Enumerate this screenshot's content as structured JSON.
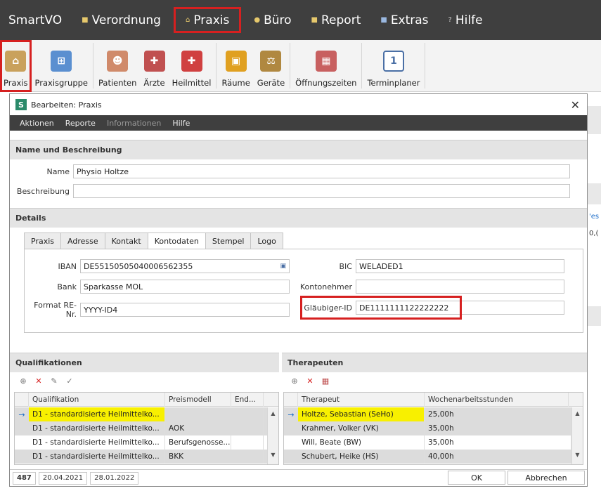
{
  "app": {
    "brand": "SmartVO",
    "menus": [
      {
        "label": "Verordnung",
        "icon": "verordnung-icon"
      },
      {
        "label": "Praxis",
        "icon": "home-icon",
        "active": true
      },
      {
        "label": "Büro",
        "icon": "buero-icon"
      },
      {
        "label": "Report",
        "icon": "report-icon"
      },
      {
        "label": "Extras",
        "icon": "extras-icon"
      },
      {
        "label": "Hilfe",
        "icon": "help-icon"
      }
    ]
  },
  "ribbon": [
    {
      "label": "Praxis",
      "icon": "house-icon",
      "color": "#c9a15c",
      "selected": true
    },
    {
      "label": "Praxisgruppe",
      "icon": "network-icon",
      "color": "#5a8fd0"
    },
    {
      "label": "Patienten",
      "icon": "patient-icon",
      "color": "#d08a6a"
    },
    {
      "label": "Ärzte",
      "icon": "doctor-icon",
      "color": "#c05050"
    },
    {
      "label": "Heilmittel",
      "icon": "firstaid-icon",
      "color": "#d04040"
    },
    {
      "label": "Räume",
      "icon": "lock-icon",
      "color": "#e0a020"
    },
    {
      "label": "Geräte",
      "icon": "scales-icon",
      "color": "#b08840"
    },
    {
      "label": "Öffnungszeiten",
      "icon": "calendar-icon",
      "color": "#c86060"
    },
    {
      "label": "Terminplaner",
      "icon": "calendar-day-icon",
      "color": "#4a6fa5",
      "glyph": "1"
    }
  ],
  "dialog": {
    "title": "Bearbeiten: Praxis",
    "icon_letter": "S",
    "close": "✕",
    "menu": [
      "Aktionen",
      "Reporte",
      "Informationen",
      "Hilfe"
    ],
    "name_section": "Name und Beschreibung",
    "name_label": "Name",
    "name_value": "Physio Holtze",
    "desc_label": "Beschreibung",
    "desc_value": "",
    "details_section": "Details",
    "tabs": [
      "Praxis",
      "Adresse",
      "Kontakt",
      "Kontodaten",
      "Stempel",
      "Logo"
    ],
    "active_tab": "Kontodaten",
    "iban_label": "IBAN",
    "iban_value": "DE55150505040006562355",
    "bic_label": "BIC",
    "bic_value": "WELADED1",
    "bank_label": "Bank",
    "bank_value": "Sparkasse MOL",
    "kontoinhaber_label": "Kontonehmer",
    "kontoinhaber_value": "",
    "format_label": "Format RE-Nr.",
    "format_value": "YYYY-ID4",
    "glaeubiger_label": "Gläubiger-ID",
    "glaeubiger_value": "DE1111111122222222",
    "quali": {
      "title": "Qualifikationen",
      "columns": [
        "Qualifikation",
        "Preismodell",
        "End..."
      ],
      "rows": [
        {
          "q": "D1 - standardisierte Heilmittelko...",
          "p": "",
          "e": ""
        },
        {
          "q": "D1 - standardisierte Heilmittelko...",
          "p": "AOK",
          "e": ""
        },
        {
          "q": "D1 - standardisierte Heilmittelko...",
          "p": "Berufsgenosse...",
          "e": ""
        },
        {
          "q": "D1 - standardisierte Heilmittelko...",
          "p": "BKK",
          "e": ""
        }
      ]
    },
    "thera": {
      "title": "Therapeuten",
      "columns": [
        "Therapeut",
        "Wochenarbeitsstunden"
      ],
      "rows": [
        {
          "t": "Holtze, Sebastian (SeHo)",
          "h": "25,00h"
        },
        {
          "t": "Krahmer, Volker (VK)",
          "h": "35,00h"
        },
        {
          "t": "Will, Beate (BW)",
          "h": "35,00h"
        },
        {
          "t": "Schubert, Heike (HS)",
          "h": "40,00h"
        }
      ]
    },
    "status": {
      "id": "487",
      "created": "20.04.2021",
      "modified": "28.01.2022"
    },
    "ok": "OK",
    "cancel": "Abbrechen"
  },
  "background_fragments": [
    "'es",
    "0,("
  ],
  "colors": {
    "highlight": "#f8f000",
    "annotation_red": "#d62020",
    "menu_dark": "#3f3f3f"
  }
}
